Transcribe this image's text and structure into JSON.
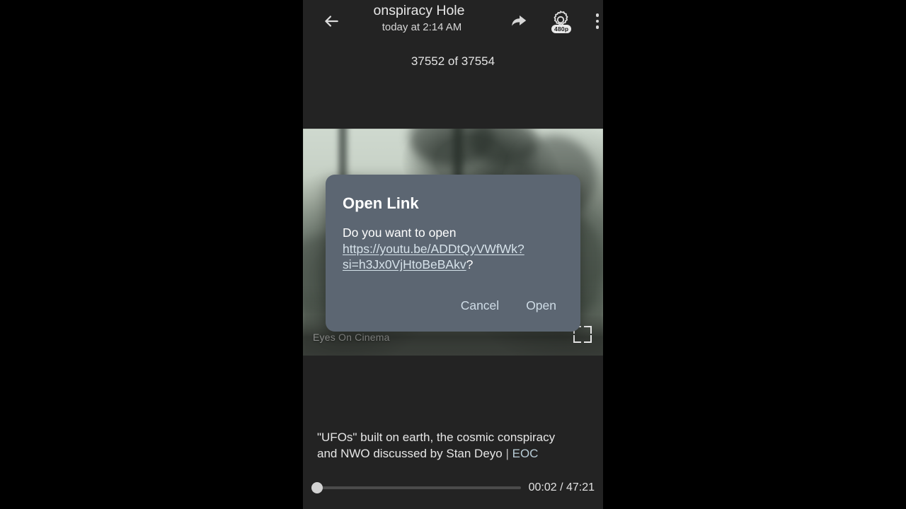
{
  "header": {
    "back_icon": "back-arrow-icon",
    "chat_title": "onspiracy Hole",
    "chat_subtitle": "today at 2:14 AM",
    "share_icon": "share-icon",
    "settings_icon": "gear-icon",
    "quality_badge": "480p",
    "overflow_icon": "more-vertical-icon"
  },
  "counter": {
    "label": "37552 of 37554"
  },
  "video": {
    "watermark": "Eyes On Cinema",
    "fullscreen_icon": "fullscreen-icon"
  },
  "dialog": {
    "title": "Open Link",
    "message_prefix": "Do you want to open ",
    "url": "https://youtu.be/ADDtQyVWfWk?si=h3Jx0VjHtoBeBAkv",
    "message_suffix": "?",
    "cancel_label": "Cancel",
    "open_label": "Open"
  },
  "caption": {
    "line1": "\"UFOs\" built on earth, the cosmic conspiracy",
    "line2_before": "and NWO discussed by Stan Deyo ",
    "separator": "| ",
    "link": "EOC"
  },
  "controls": {
    "current_time": "00:02",
    "total_time": "47:21",
    "time_display": "00:02 / 47:21",
    "progress_percent": 1
  },
  "colors": {
    "app_background": "#232323",
    "dialog_background": "#5c6672",
    "dialog_button_text": "#cfdce6",
    "link_text": "#d6e2ea",
    "caption_link": "#b8ccd6",
    "letterbox": "#000000"
  }
}
